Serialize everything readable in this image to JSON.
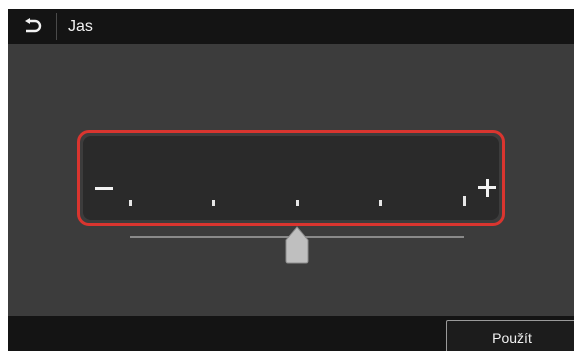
{
  "header": {
    "back_icon": "return-arrow-icon",
    "title": "Jas"
  },
  "brightness_slider": {
    "min_icon": "minus-icon",
    "max_icon": "plus-icon",
    "steps": 9,
    "current_step": 5,
    "highlight_color": "#d9352f"
  },
  "footer": {
    "apply_label": "Použít"
  },
  "colors": {
    "title_bar": "#141414",
    "background": "#3c3c3c",
    "panel": "#2a2a2a",
    "thumb": "#bfbfbf"
  }
}
